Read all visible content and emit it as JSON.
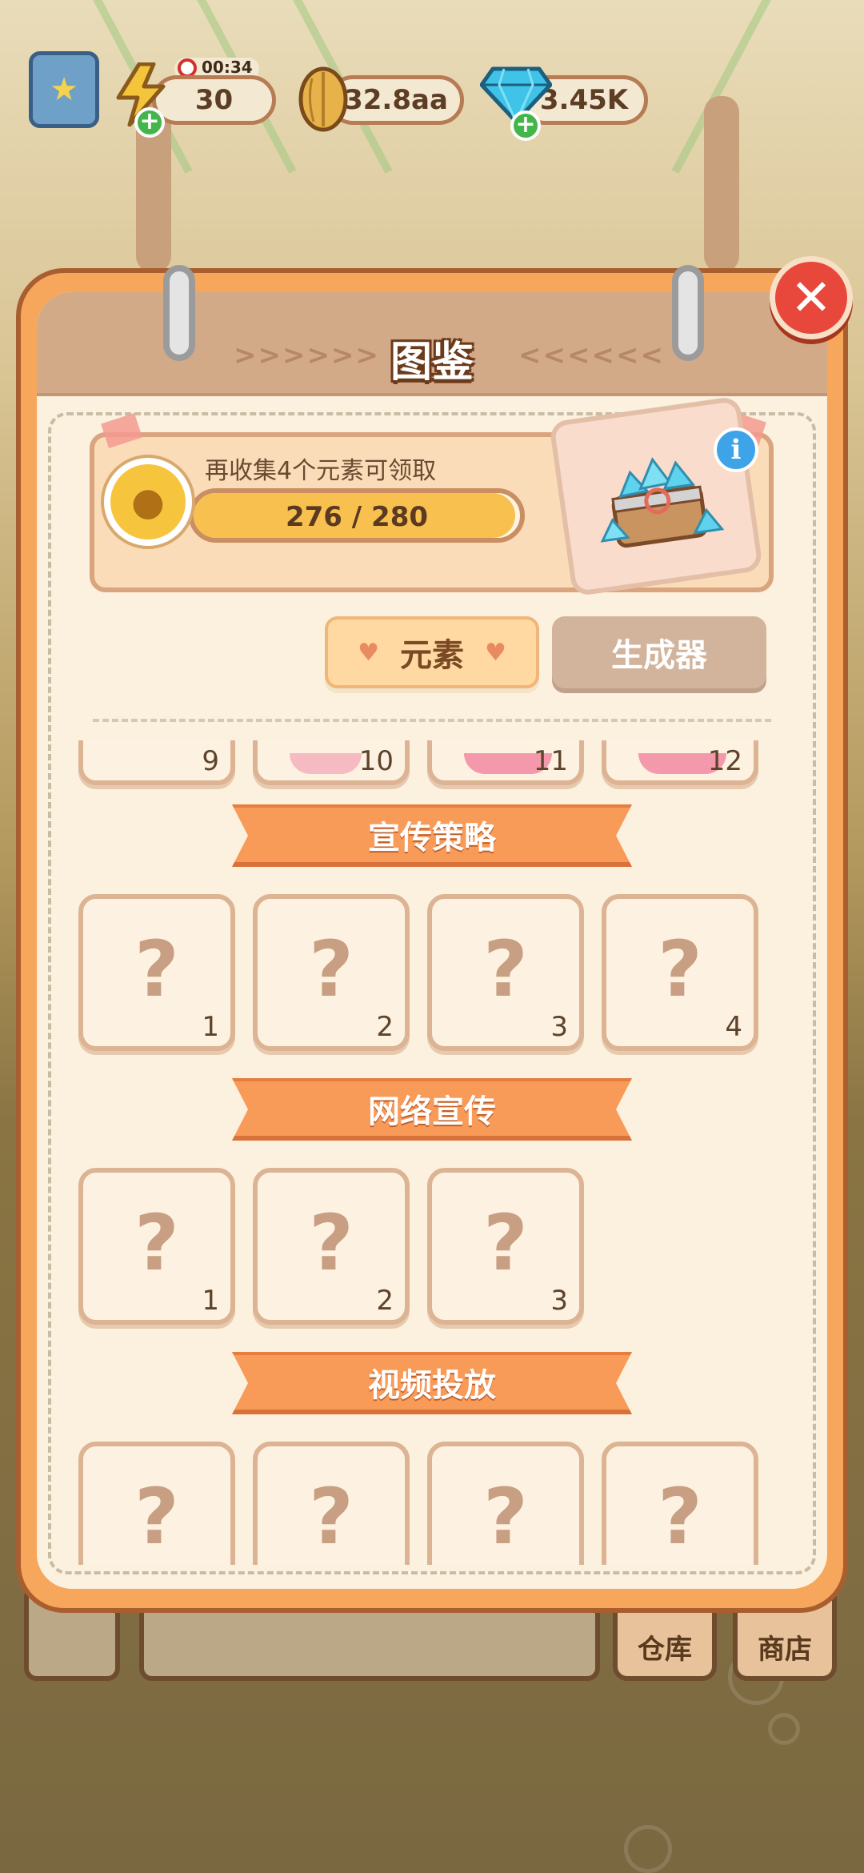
{
  "hud": {
    "energy_timer": "00:34",
    "energy_value": "30",
    "seed_value": "32.8aa",
    "gem_value": "3.45K",
    "icons": {
      "codex": "book-star-icon",
      "energy": "lightning-icon",
      "seed": "sunflower-seed-icon",
      "gem": "diamond-icon",
      "add": "plus-icon",
      "timer": "clock-icon"
    }
  },
  "panel": {
    "title": "图鉴",
    "left_arrows": ">>>>>>",
    "right_arrows": "<<<<<<",
    "close_icon": "close-icon"
  },
  "progress": {
    "label": "再收集4个元素可领取",
    "current": 276,
    "total": 280,
    "text": "276 / 280",
    "fraction": 0.986,
    "reward_icon": "gem-chest-icon",
    "coin_icon": "acorn-coin-icon",
    "info_icon": "info-icon"
  },
  "tabs": {
    "active": "元素",
    "inactive": "生成器"
  },
  "partial_row": [
    "9",
    "10",
    "11",
    "12"
  ],
  "sections": [
    {
      "title": "宣传策略",
      "cards": [
        {
          "symbol": "?",
          "num": "1"
        },
        {
          "symbol": "?",
          "num": "2"
        },
        {
          "symbol": "?",
          "num": "3"
        },
        {
          "symbol": "?",
          "num": "4"
        }
      ]
    },
    {
      "title": "网络宣传",
      "cards": [
        {
          "symbol": "?",
          "num": "1"
        },
        {
          "symbol": "?",
          "num": "2"
        },
        {
          "symbol": "?",
          "num": "3"
        }
      ]
    },
    {
      "title": "视频投放",
      "cards": [
        {
          "symbol": "?",
          "num": ""
        },
        {
          "symbol": "?",
          "num": ""
        },
        {
          "symbol": "?",
          "num": ""
        },
        {
          "symbol": "?",
          "num": ""
        }
      ]
    }
  ],
  "background": {
    "warehouse_label": "仓库",
    "shop_label": "商店"
  },
  "colors": {
    "panel_orange": "#f6a75c",
    "banner_orange": "#f89a58",
    "close_red": "#e8483b",
    "gem_blue": "#3fc3e8"
  }
}
